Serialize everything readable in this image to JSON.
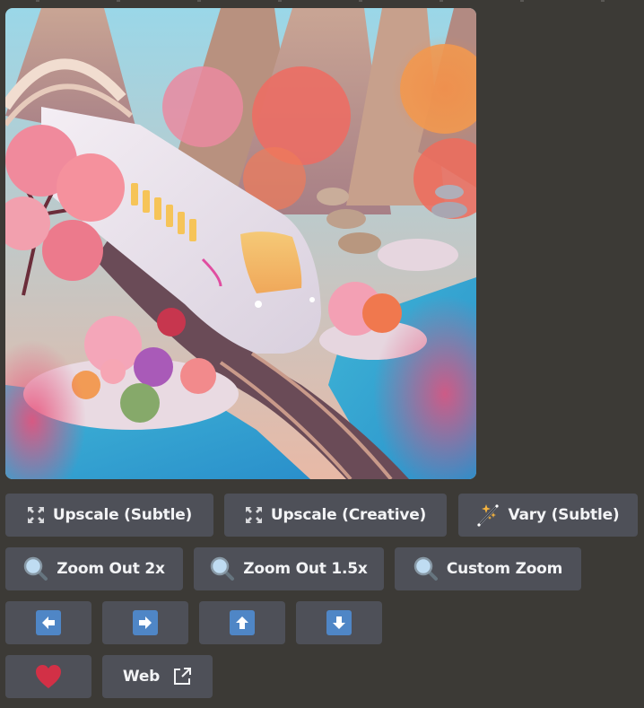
{
  "message": {
    "image": {
      "alt": "3D stylized white bullet train on curved tracks through pink and orange blossom trees, rocky islands, and turquoise water",
      "icon": "generated-image"
    },
    "rows": [
      [
        {
          "id": "upscale-subtle",
          "label": "Upscale (Subtle)",
          "icon": "upscale-icon"
        },
        {
          "id": "upscale-creative",
          "label": "Upscale (Creative)",
          "icon": "upscale-icon"
        },
        {
          "id": "vary-subtle",
          "label": "Vary (Subtle)",
          "icon": "magic-wand-icon"
        }
      ],
      [
        {
          "id": "zoom-out-2x",
          "label": "Zoom Out 2x",
          "icon": "magnifier-icon"
        },
        {
          "id": "zoom-out-1-5x",
          "label": "Zoom Out 1.5x",
          "icon": "magnifier-icon"
        },
        {
          "id": "custom-zoom",
          "label": "Custom Zoom",
          "icon": "magnifier-icon"
        }
      ],
      [
        {
          "id": "pan-left",
          "label": "",
          "icon": "arrow-left-icon"
        },
        {
          "id": "pan-right",
          "label": "",
          "icon": "arrow-right-icon"
        },
        {
          "id": "pan-up",
          "label": "",
          "icon": "arrow-up-icon"
        },
        {
          "id": "pan-down",
          "label": "",
          "icon": "arrow-down-icon"
        }
      ],
      [
        {
          "id": "favorite",
          "label": "",
          "icon": "heart-icon"
        },
        {
          "id": "web",
          "label": "Web",
          "icon": "external-link-icon"
        }
      ]
    ]
  },
  "colors": {
    "background": "#3c3a36",
    "button": "#4e5058",
    "button_text": "#f2f3f5",
    "arrow_accent": "#4f86c6",
    "heart": "#dd2e44",
    "sparkle": "#f4b33f",
    "magnifier_lens": "#bfdcf2"
  }
}
